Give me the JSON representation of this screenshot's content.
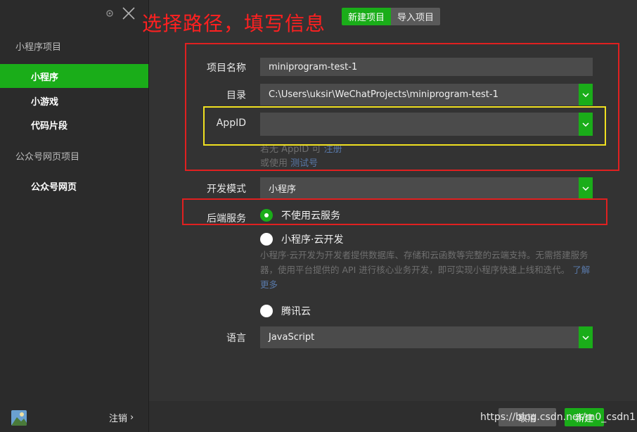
{
  "annotation": {
    "title": "选择路径，填写信息"
  },
  "top_tabs": [
    {
      "label": "新建项目"
    },
    {
      "label": "导入项目"
    }
  ],
  "sidebar": {
    "group1_label": "小程序项目",
    "items": [
      {
        "label": "小程序"
      },
      {
        "label": "小游戏"
      },
      {
        "label": "代码片段"
      }
    ],
    "group2_label": "公众号网页项目",
    "group2_items": [
      {
        "label": "公众号网页"
      }
    ],
    "logout_label": "注销",
    "logout_chevron": "›"
  },
  "form": {
    "project_name_label": "项目名称",
    "project_name_value": "miniprogram-test-1",
    "directory_label": "目录",
    "directory_value": "C:\\Users\\uksir\\WeChatProjects\\miniprogram-test-1",
    "appid_label": "AppID",
    "appid_value": "",
    "appid_hint_prefix": "若无 AppID 可",
    "appid_hint_link": "注册",
    "appid_hint2_prefix": "或使用",
    "appid_hint2_link": "测试号",
    "dev_mode_label": "开发模式",
    "dev_mode_value": "小程序",
    "backend_label": "后端服务",
    "backend_options": [
      {
        "label": "不使用云服务",
        "checked": true
      },
      {
        "label": "小程序·云开发",
        "checked": false
      },
      {
        "label": "腾讯云",
        "checked": false
      }
    ],
    "cloud_desc": "小程序·云开发为开发者提供数据库、存储和云函数等完整的云端支持。无需搭建服务器，使用平台提供的 API 进行核心业务开发，即可实现小程序快速上线和迭代。",
    "cloud_desc_link": "了解更多",
    "language_label": "语言",
    "language_value": "JavaScript"
  },
  "footer": {
    "cancel_label": "取消",
    "create_label": "新建",
    "watermark": "https://blog.csdn.net/m0_csdn1"
  },
  "colors": {
    "accent": "#1aad19",
    "annotation_red": "#e02020",
    "annotation_yellow": "#f0e020"
  }
}
